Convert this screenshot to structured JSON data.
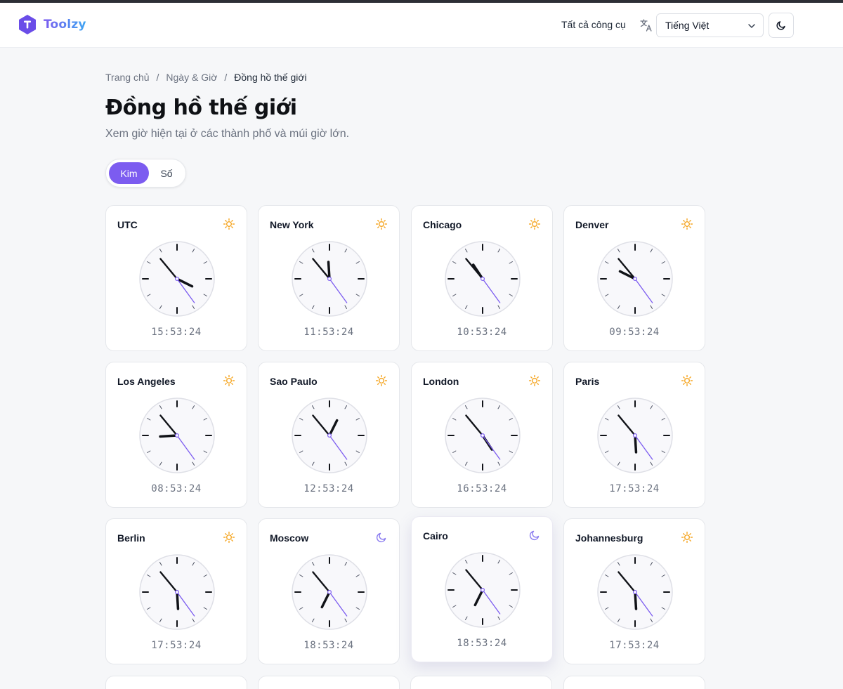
{
  "header": {
    "brand": "Toolzy",
    "nav_all": "Tất cả công cụ",
    "language": "Tiếng Việt"
  },
  "breadcrumb": {
    "home": "Trang chủ",
    "section": "Ngày & Giờ",
    "current": "Đồng hồ thế giới",
    "separator": "/"
  },
  "page": {
    "title": "Đồng hồ thế giới",
    "subtitle": "Xem giờ hiện tại ở các thành phố và múi giờ lớn."
  },
  "view_toggle": {
    "analog": "Kim",
    "digital": "Số",
    "selected": "analog"
  },
  "colors": {
    "accent": "#7c5cf0",
    "sun": "#f5a623",
    "moon": "#8b7cf0",
    "hand": "#111318"
  },
  "clocks": [
    {
      "city": "UTC",
      "time": "15:53:24",
      "state": "day"
    },
    {
      "city": "New York",
      "time": "11:53:24",
      "state": "day"
    },
    {
      "city": "Chicago",
      "time": "10:53:24",
      "state": "day"
    },
    {
      "city": "Denver",
      "time": "09:53:24",
      "state": "day"
    },
    {
      "city": "Los Angeles",
      "time": "08:53:24",
      "state": "day"
    },
    {
      "city": "Sao Paulo",
      "time": "12:53:24",
      "state": "day"
    },
    {
      "city": "London",
      "time": "16:53:24",
      "state": "day"
    },
    {
      "city": "Paris",
      "time": "17:53:24",
      "state": "day"
    },
    {
      "city": "Berlin",
      "time": "17:53:24",
      "state": "day"
    },
    {
      "city": "Moscow",
      "time": "18:53:24",
      "state": "night"
    },
    {
      "city": "Cairo",
      "time": "18:53:24",
      "state": "night"
    },
    {
      "city": "Johannesburg",
      "time": "17:53:24",
      "state": "day"
    }
  ]
}
